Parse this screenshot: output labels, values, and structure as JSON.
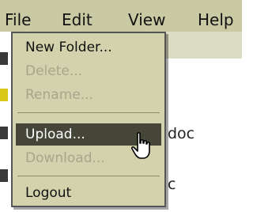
{
  "menubar": {
    "items": [
      "File",
      "Edit",
      "View",
      "Help"
    ]
  },
  "file_menu": {
    "items": [
      {
        "label": "New Folder...",
        "enabled": true
      },
      {
        "label": "Delete...",
        "enabled": false
      },
      {
        "label": "Rename...",
        "enabled": false
      },
      {
        "label": "Upload...",
        "enabled": true,
        "highlighted": true
      },
      {
        "label": "Download...",
        "enabled": false
      },
      {
        "label": "Logout",
        "enabled": true
      }
    ]
  },
  "background": {
    "partial_labels": [
      "doc",
      "c"
    ]
  },
  "colors": {
    "menubar_bg": "#c9c9a3",
    "menu_bg": "#d2d2ad",
    "highlight_bg": "#454538",
    "disabled_text": "#a6a68a"
  },
  "cursor": "hand-pointer-icon"
}
